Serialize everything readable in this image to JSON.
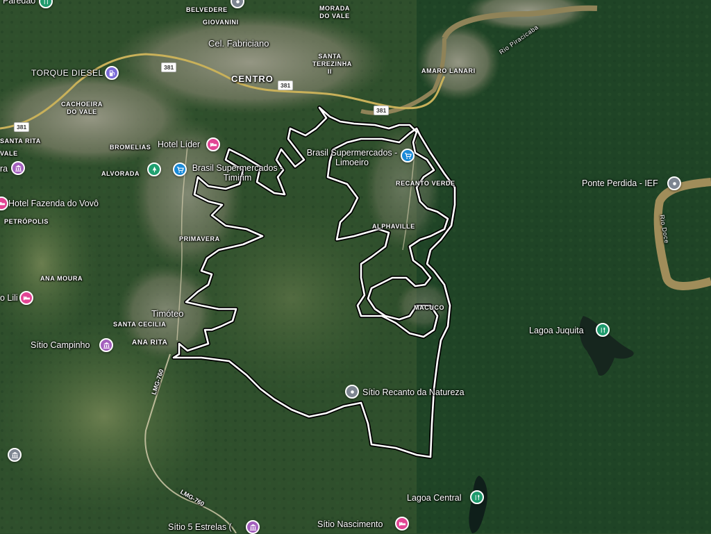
{
  "map": {
    "type": "satellite",
    "colors": {
      "forest": "#23452a",
      "urban": "#8a8a78",
      "river": "#9a8a5a",
      "route": "#ffffff",
      "route_casing": "#000000"
    }
  },
  "districts": [
    "BELVEDERE",
    "GIOVANINI",
    "MORADA DO VALE",
    "CENTRO",
    "SANTA TEREZINHA II",
    "AMARO LANARI",
    "CACHOEIRA DO VALE",
    "BROMELIAS",
    "ALVORADA",
    "RECANTO VERDE",
    "ALPHAVILLE",
    "PRIMAVERA",
    "ANA MOURA",
    "SANTA CECILIA",
    "ANA RITA",
    "MACUCO",
    "PETRÓPOLIS",
    "SANTA RITA",
    "VALE"
  ],
  "places": {
    "cel_fabriciano": "Cel. Fabriciano",
    "timoteo": "Timóteo",
    "torque_diesel": "TORQUE DIESEL",
    "hotel_lider": "Hotel Líder",
    "brasil_supermercados_limoeiro": "Brasil Supermercados - Limoeiro",
    "brasil_supermercados_timirim": "Brasil Supermercados - Timirim",
    "hotel_fazenda": "Hotel Fazenda do Vovô",
    "ponte_perdida": "Ponte Perdida - IEF",
    "lagoa_juquita": "Lagoa Juquita",
    "lagoa_central": "Lagoa Central",
    "sitio_recanto": "Sítio Recanto da Natureza",
    "sitio_campinho": "Sítio Campinho",
    "sitio_nascimento": "Sítio Nascimento",
    "sitio_5_estrelas": "Sítio 5 Estrelas (",
    "lili": "o Lili",
    "paredao": "Paredão",
    "ra": "ra",
    "rio_piracicaba": "Rio Piracicaba",
    "rio_doce": "Rio Doce"
  },
  "roads": [
    "381",
    "LMG-760"
  ],
  "icons": {
    "hotel": "bed-icon",
    "shop": "shopping-cart-icon",
    "fuel": "gas-station-icon",
    "museum": "landmark-icon",
    "generic": "dot-pin-icon",
    "park": "park-icon"
  }
}
